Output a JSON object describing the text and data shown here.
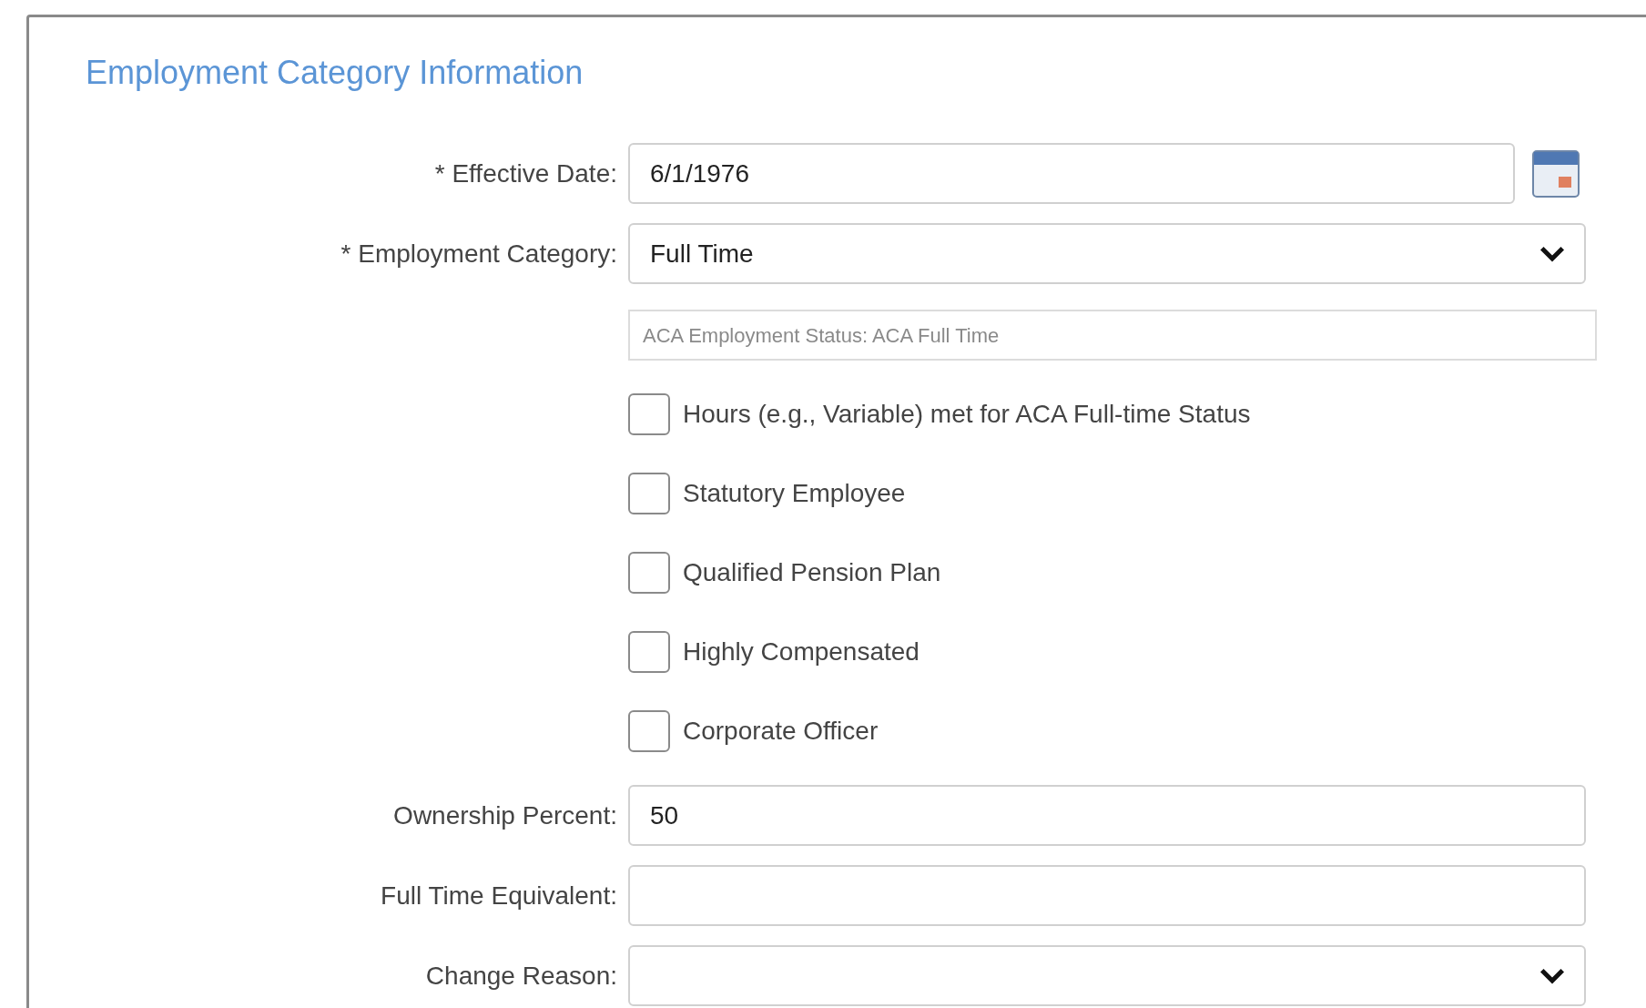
{
  "section": {
    "title": "Employment Category Information"
  },
  "fields": [
    {
      "kind": "date",
      "label": "* Effective Date:",
      "value": "6/1/1976"
    },
    {
      "kind": "select",
      "label": "* Employment Category:",
      "value": "Full Time"
    },
    {
      "kind": "info",
      "text": "ACA Employment Status: ACA Full Time"
    },
    {
      "kind": "checkbox",
      "label": "Hours (e.g., Variable) met for ACA Full-time Status",
      "checked": false
    },
    {
      "kind": "checkbox",
      "label": "Statutory Employee",
      "checked": false
    },
    {
      "kind": "checkbox",
      "label": "Qualified Pension Plan",
      "checked": false
    },
    {
      "kind": "checkbox",
      "label": "Highly Compensated",
      "checked": false
    },
    {
      "kind": "checkbox",
      "label": "Corporate Officer",
      "checked": false
    },
    {
      "kind": "text",
      "label": "Ownership Percent:",
      "value": "50"
    },
    {
      "kind": "text",
      "label": "Full Time Equivalent:"
    },
    {
      "kind": "select",
      "label": "Change Reason:"
    }
  ]
}
